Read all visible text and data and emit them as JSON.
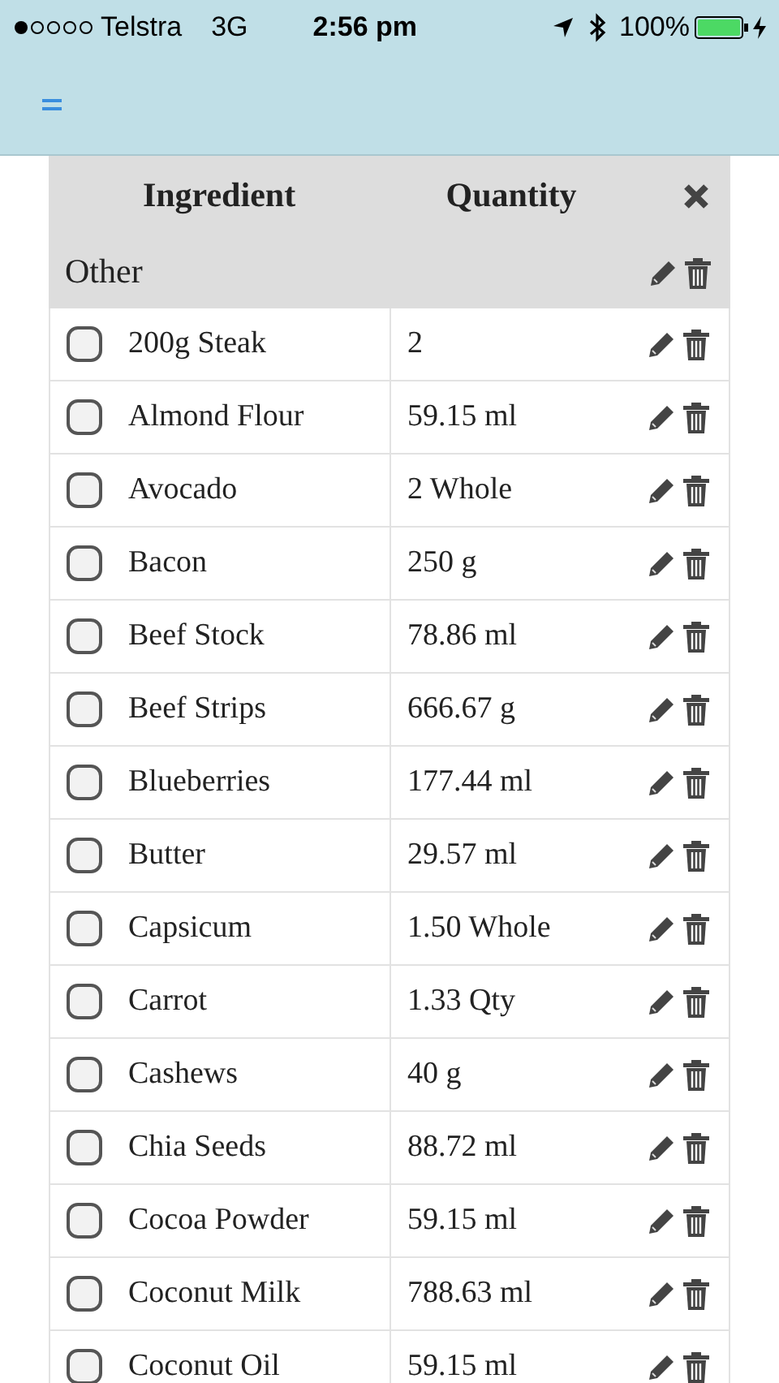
{
  "status_bar": {
    "carrier": "Telstra",
    "network": "3G",
    "time": "2:56 pm",
    "battery": "100%"
  },
  "table": {
    "columns": [
      "Ingredient",
      "Quantity"
    ],
    "group": {
      "title": "Other"
    },
    "rows": [
      {
        "ingredient": "200g Steak",
        "quantity": "2",
        "checked": false
      },
      {
        "ingredient": "Almond Flour",
        "quantity": "59.15 ml",
        "checked": false
      },
      {
        "ingredient": "Avocado",
        "quantity": "2 Whole",
        "checked": false
      },
      {
        "ingredient": "Bacon",
        "quantity": "250 g",
        "checked": false
      },
      {
        "ingredient": "Beef Stock",
        "quantity": "78.86 ml",
        "checked": false
      },
      {
        "ingredient": "Beef Strips",
        "quantity": "666.67 g",
        "checked": false
      },
      {
        "ingredient": "Blueberries",
        "quantity": "177.44 ml",
        "checked": false
      },
      {
        "ingredient": "Butter",
        "quantity": "29.57 ml",
        "checked": false
      },
      {
        "ingredient": "Capsicum",
        "quantity": "1.50 Whole",
        "checked": false
      },
      {
        "ingredient": "Carrot",
        "quantity": "1.33 Qty",
        "checked": false
      },
      {
        "ingredient": "Cashews",
        "quantity": "40 g",
        "checked": false
      },
      {
        "ingredient": "Chia Seeds",
        "quantity": "88.72 ml",
        "checked": false
      },
      {
        "ingredient": "Cocoa Powder",
        "quantity": "59.15 ml",
        "checked": false
      },
      {
        "ingredient": "Coconut Milk",
        "quantity": "788.63 ml",
        "checked": false
      },
      {
        "ingredient": "Coconut Oil",
        "quantity": "59.15 ml",
        "checked": false
      }
    ]
  }
}
